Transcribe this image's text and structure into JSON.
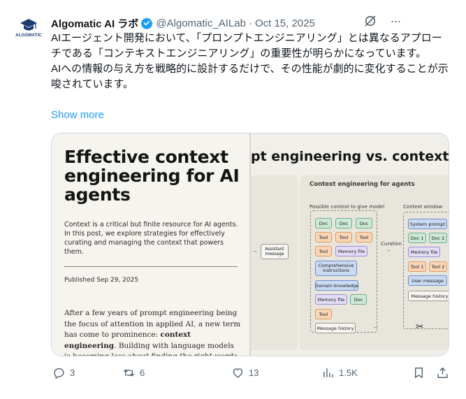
{
  "author": {
    "display_name": "Algomatic AI ラボ",
    "handle": "@Algomatic_AILab",
    "separator": "·",
    "date": "Oct 15, 2025",
    "avatar_label": "ALGOMATIC"
  },
  "tweet": {
    "paragraph1": "AIエージェント開発において、「プロンプトエンジニアリング」とは異なるアプローチである「コンテキストエンジニアリング」の重要性が明らかになっています。",
    "paragraph2": "AIへの情報の与え方を戦略的に設計するだけで、その性能が劇的に変化することが示唆されています。",
    "show_more": "Show more"
  },
  "article": {
    "title": "Effective context engineering for AI agents",
    "summary": "Context is a critical but finite resource for AI agents. In this post, we explore strategies for effectively curating and managing the context that powers them.",
    "published": "Published Sep 29, 2025",
    "body_before": "After a few years of prompt engineering being the focus of attention in applied AI, a new term has come to prominence: ",
    "body_bold": "context engineering",
    "body_after": ". Building with language models is becoming less about finding the right words and phrases for your prompts, and more"
  },
  "diagram": {
    "title": "pt engineering vs. context engine",
    "panel_title": "Context engineering for agents",
    "possible_label": "Possible context to give model",
    "window_label": "Context window",
    "curation_label": "Curation",
    "assistant_message": "Assistant message",
    "doc": "Doc",
    "tool": "Tool",
    "memory_file": "Memory file",
    "comprehensive": "Comprehensive instructions",
    "domain_knowledge": "Domain knowledge",
    "message_history": "Message history",
    "system_prompt": "System prompt",
    "doc1": "Doc 1",
    "doc2": "Doc 2",
    "tool1": "Tool 1",
    "tool2": "Tool 2",
    "user_message": "User message"
  },
  "actions": {
    "replies": "3",
    "reposts": "6",
    "likes": "13",
    "views": "1.5K"
  },
  "colors": {
    "accent": "#1d9bf0",
    "verified": "#1d9bf0",
    "muted": "#536471"
  }
}
